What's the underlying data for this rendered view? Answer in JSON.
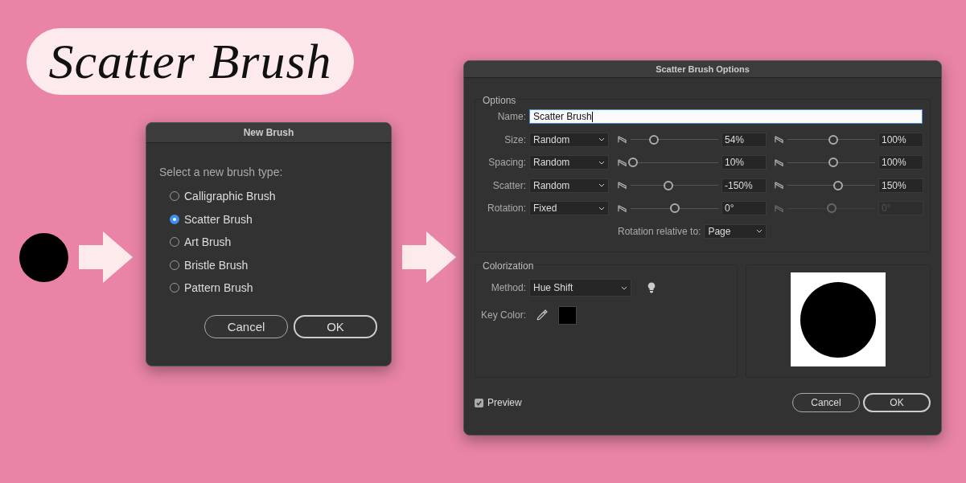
{
  "heading": "Scatter Brush",
  "new_brush": {
    "title": "New Brush",
    "prompt": "Select a new brush type:",
    "options": [
      {
        "label": "Calligraphic Brush",
        "selected": false
      },
      {
        "label": "Scatter Brush",
        "selected": true
      },
      {
        "label": "Art Brush",
        "selected": false
      },
      {
        "label": "Bristle Brush",
        "selected": false
      },
      {
        "label": "Pattern Brush",
        "selected": false
      }
    ],
    "buttons": [
      {
        "label": "Cancel",
        "default": false
      },
      {
        "label": "OK",
        "default": true
      }
    ]
  },
  "options_dialog": {
    "title": "Scatter Brush Options",
    "group_label": "Options",
    "name_label": "Name:",
    "name_value": "Scatter Brush",
    "rows": [
      {
        "label": "Size:",
        "mode": "Random",
        "min": {
          "level": 0.27,
          "value": "54%",
          "disabled": false
        },
        "max": {
          "level": 0.52,
          "value": "100%",
          "disabled": false
        }
      },
      {
        "label": "Spacing:",
        "mode": "Random",
        "min": {
          "level": 0.03,
          "value": "10%",
          "disabled": false
        },
        "max": {
          "level": 0.52,
          "value": "100%",
          "disabled": false
        }
      },
      {
        "label": "Scatter:",
        "mode": "Random",
        "min": {
          "level": 0.43,
          "value": "-150%",
          "disabled": false
        },
        "max": {
          "level": 0.58,
          "value": "150%",
          "disabled": false
        }
      },
      {
        "label": "Rotation:",
        "mode": "Fixed",
        "min": {
          "level": 0.5,
          "value": "0°",
          "disabled": false
        },
        "max": {
          "level": 0.5,
          "value": "0°",
          "disabled": true
        }
      }
    ],
    "rotation_relative_label": "Rotation relative to:",
    "rotation_relative_value": "Page",
    "colorization": {
      "group_label": "Colorization",
      "method_label": "Method:",
      "method": "Hue Shift",
      "key_color_label": "Key Color:"
    },
    "preview": {
      "label": "Preview",
      "checked": true
    },
    "buttons": [
      {
        "label": "Cancel",
        "default": false
      },
      {
        "label": "OK",
        "default": true
      }
    ]
  }
}
